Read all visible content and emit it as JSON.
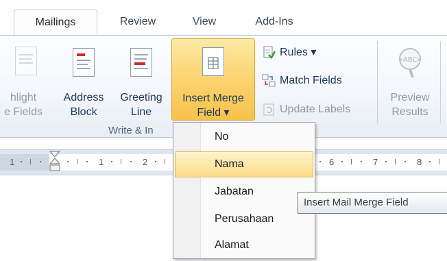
{
  "tabs": [
    {
      "label": "Mailings",
      "active": true
    },
    {
      "label": "Review",
      "active": false
    },
    {
      "label": "View",
      "active": false
    },
    {
      "label": "Add-Ins",
      "active": false
    }
  ],
  "ribbon": {
    "highlight_label": "hlight\ne Fields",
    "address_block_label": "Address\nBlock",
    "greeting_line_label": "Greeting\nLine",
    "insert_merge_field_label": "Insert Merge\nField ▾",
    "rules_label": "Rules ▾",
    "match_fields_label": "Match Fields",
    "update_labels_label": "Update Labels",
    "preview_results_label": "Preview\nResults",
    "preview_badge": "«ABC»",
    "group_label": "Write & In"
  },
  "ruler": {
    "numbers": [
      "1",
      "1",
      "2",
      "6",
      "7",
      "8"
    ]
  },
  "merge_field_menu": {
    "items": [
      "No",
      "Nama",
      "Jabatan",
      "Perusahaan",
      "Alamat"
    ],
    "highlighted": "Nama"
  },
  "tooltip": {
    "text": "Insert Mail Merge Field"
  },
  "colors": {
    "hot_button": "#f7c24a",
    "ribbon_text": "#1e395b",
    "menu_highlight": "#fbdc87"
  }
}
